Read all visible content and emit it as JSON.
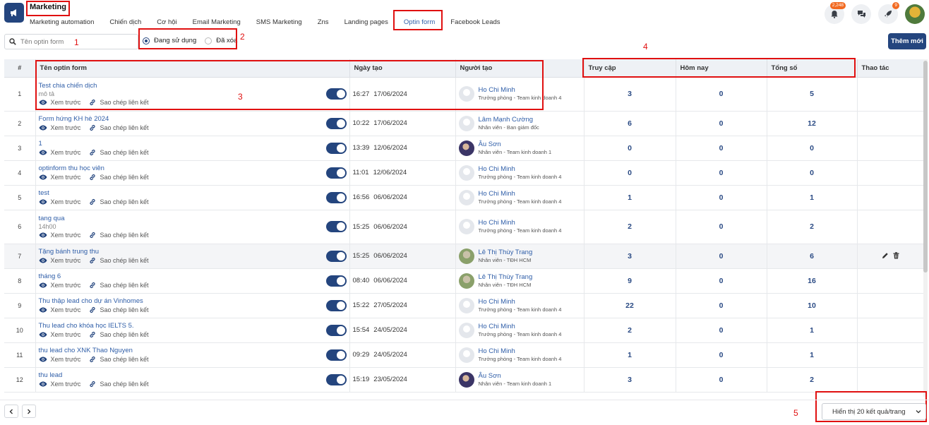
{
  "app": {
    "title": "Marketing"
  },
  "tabs": [
    {
      "label": "Marketing automation",
      "active": false
    },
    {
      "label": "Chiến dịch",
      "active": false
    },
    {
      "label": "Cơ hội",
      "active": false
    },
    {
      "label": "Email Marketing",
      "active": false
    },
    {
      "label": "SMS Marketing",
      "active": false
    },
    {
      "label": "Zns",
      "active": false
    },
    {
      "label": "Landing pages",
      "active": false
    },
    {
      "label": "Optin form",
      "active": true
    },
    {
      "label": "Facebook Leads",
      "active": false
    }
  ],
  "header": {
    "notification_badge": "2,248",
    "rocket_badge": "9"
  },
  "search": {
    "placeholder": "Tên optin form"
  },
  "filters": {
    "active_label": "Đang sử dụng",
    "deleted_label": "Đã xóa",
    "selected": "active"
  },
  "actions": {
    "add_label": "Thêm mới"
  },
  "annotations": [
    "1",
    "2",
    "3",
    "4",
    "5"
  ],
  "table": {
    "columns": [
      "#",
      "Tên optin form",
      "Ngày tạo",
      "Người tạo",
      "Truy cập",
      "Hôm nay",
      "Tổng số",
      "Thao tác"
    ],
    "preview_label": "Xem trước",
    "copy_label": "Sao chép liên kết",
    "rows": [
      {
        "num": "1",
        "name": "Test chia chiến dịch",
        "desc": "mô tả",
        "time": "16:27",
        "date": "17/06/2024",
        "creator": "Ho Chi Minh",
        "role": "Trưởng phòng - Team kinh doanh 4",
        "avatar": "blank",
        "visits": "3",
        "today": "0",
        "total": "5"
      },
      {
        "num": "2",
        "name": "Form hứng KH hè 2024",
        "desc": "",
        "time": "10:22",
        "date": "17/06/2024",
        "creator": "Lâm Mạnh Cường",
        "role": "Nhân viên - Ban giám đốc",
        "avatar": "blank",
        "visits": "6",
        "today": "0",
        "total": "12"
      },
      {
        "num": "3",
        "name": "1",
        "desc": "",
        "time": "13:39",
        "date": "12/06/2024",
        "creator": "Âu Sơn",
        "role": "Nhân viên - Team kinh doanh 1",
        "avatar": "photo1",
        "visits": "0",
        "today": "0",
        "total": "0"
      },
      {
        "num": "4",
        "name": "optinform thu học viên",
        "desc": "",
        "time": "11:01",
        "date": "12/06/2024",
        "creator": "Ho Chi Minh",
        "role": "Trưởng phòng - Team kinh doanh 4",
        "avatar": "blank",
        "visits": "0",
        "today": "0",
        "total": "0"
      },
      {
        "num": "5",
        "name": "test",
        "desc": "",
        "time": "16:56",
        "date": "06/06/2024",
        "creator": "Ho Chi Minh",
        "role": "Trưởng phòng - Team kinh doanh 4",
        "avatar": "blank",
        "visits": "1",
        "today": "0",
        "total": "1"
      },
      {
        "num": "6",
        "name": "tang qua",
        "desc": "14h00",
        "time": "15:25",
        "date": "06/06/2024",
        "creator": "Ho Chi Minh",
        "role": "Trưởng phòng - Team kinh doanh 4",
        "avatar": "blank",
        "visits": "2",
        "today": "0",
        "total": "2"
      },
      {
        "num": "7",
        "name": "Tặng bánh trung thu",
        "desc": "",
        "time": "15:25",
        "date": "06/06/2024",
        "creator": "Lê Thị Thùy Trang",
        "role": "Nhân viên - TĐH HCM",
        "avatar": "photo2",
        "visits": "3",
        "today": "0",
        "total": "6",
        "highlight": true
      },
      {
        "num": "8",
        "name": "tháng 6",
        "desc": "",
        "time": "08:40",
        "date": "06/06/2024",
        "creator": "Lê Thị Thùy Trang",
        "role": "Nhân viên - TĐH HCM",
        "avatar": "photo2",
        "visits": "9",
        "today": "0",
        "total": "16"
      },
      {
        "num": "9",
        "name": "Thu thập lead cho dự án Vinhomes",
        "desc": "",
        "time": "15:22",
        "date": "27/05/2024",
        "creator": "Ho Chi Minh",
        "role": "Trưởng phòng - Team kinh doanh 4",
        "avatar": "blank",
        "visits": "22",
        "today": "0",
        "total": "10"
      },
      {
        "num": "10",
        "name": "Thu lead cho khóa học IELTS 5.",
        "desc": "",
        "time": "15:54",
        "date": "24/05/2024",
        "creator": "Ho Chi Minh",
        "role": "Trưởng phòng - Team kinh doanh 4",
        "avatar": "blank",
        "visits": "2",
        "today": "0",
        "total": "1"
      },
      {
        "num": "11",
        "name": "thu lead cho XNK Thao Nguyen",
        "desc": "",
        "time": "09:29",
        "date": "24/05/2024",
        "creator": "Ho Chi Minh",
        "role": "Trưởng phòng - Team kinh doanh 4",
        "avatar": "blank",
        "visits": "1",
        "today": "0",
        "total": "1"
      },
      {
        "num": "12",
        "name": "thu lead",
        "desc": "",
        "time": "15:19",
        "date": "23/05/2024",
        "creator": "Âu Sơn",
        "role": "Nhân viên - Team kinh doanh 1",
        "avatar": "photo1",
        "visits": "3",
        "today": "0",
        "total": "2"
      }
    ]
  },
  "footer": {
    "page_size_label": "Hiển thị 20 kết quả/trang"
  },
  "colors": {
    "primary": "#24457e",
    "link": "#2f5ea8",
    "annotation": "#e01010",
    "badge": "#f26a21"
  }
}
